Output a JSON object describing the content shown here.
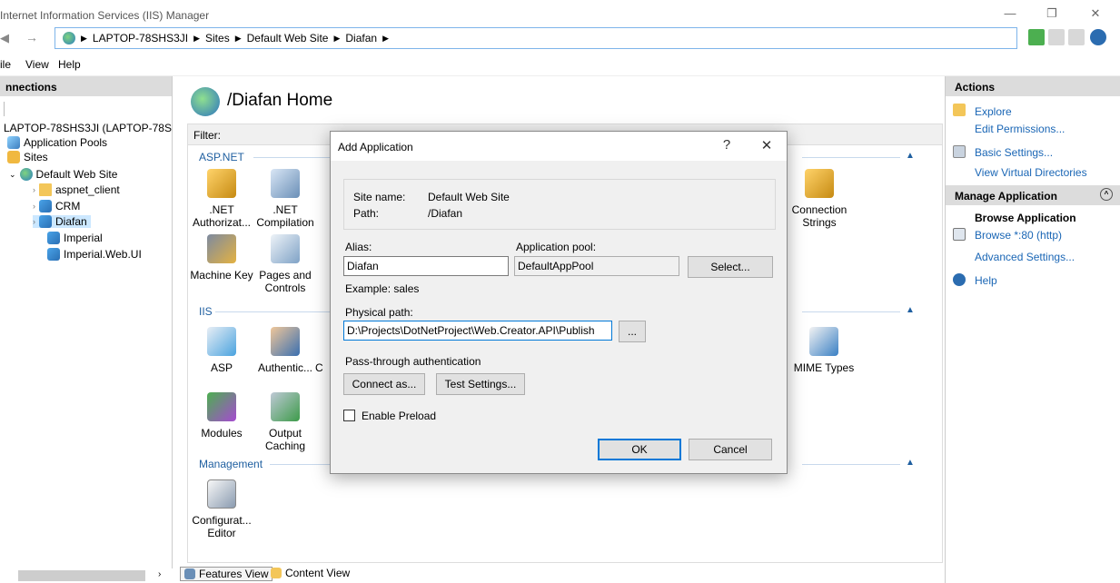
{
  "window": {
    "title": "Internet Information Services (IIS) Manager"
  },
  "address": {
    "crumbs": [
      "LAPTOP-78SHS3JI",
      "Sites",
      "Default Web Site",
      "Diafan"
    ]
  },
  "menu": {
    "items": [
      "ile",
      "View",
      "Help"
    ]
  },
  "connections": {
    "header": "nnections",
    "tree": [
      {
        "label": "LAPTOP-78SHS3JI (LAPTOP-78SH",
        "icon": "server-icon"
      },
      {
        "label": "Application Pools",
        "icon": "app-pool-icon"
      },
      {
        "label": "Sites",
        "icon": "sites-icon"
      },
      {
        "label": "Default Web Site",
        "icon": "globe-icon"
      },
      {
        "label": "aspnet_client",
        "icon": "folder-icon"
      },
      {
        "label": "CRM",
        "icon": "application-icon"
      },
      {
        "label": "Diafan",
        "icon": "application-icon"
      },
      {
        "label": "Imperial",
        "icon": "application-icon"
      },
      {
        "label": "Imperial.Web.UI",
        "icon": "application-icon"
      }
    ]
  },
  "center": {
    "title": "/Diafan Home",
    "filter_label": "Filter:",
    "groups": {
      "aspnet": "ASP.NET",
      "iis": "IIS",
      "management": "Management"
    },
    "features": {
      "net_auth": ".NET\nAuthorizat...",
      "net_comp": ".NET\nCompilation",
      "conn_strings": "Connection\nStrings",
      "machine_key": "Machine Key",
      "pages_controls": "Pages and\nControls",
      "asp": "ASP",
      "authentication": "Authentic...",
      "auth_c": "C",
      "mime": "MIME Types",
      "modules": "Modules",
      "output_caching": "Output\nCaching",
      "config_editor": "Configurat...\nEditor"
    }
  },
  "bottom_tabs": {
    "features": "Features View",
    "content": "Content View"
  },
  "actions": {
    "header": "Actions",
    "explore": "Explore",
    "edit_permissions": "Edit Permissions...",
    "basic_settings": "Basic Settings...",
    "view_virtual_dirs": "View Virtual Directories",
    "manage_header": "Manage Application",
    "browse_app": "Browse Application",
    "browse_80": "Browse *:80 (http)",
    "advanced_settings": "Advanced Settings...",
    "help": "Help"
  },
  "dialog": {
    "title": "Add Application",
    "help_glyph": "?",
    "close_glyph": "✕",
    "site_name_label": "Site name:",
    "site_name_value": "Default Web Site",
    "path_label": "Path:",
    "path_value": "/Diafan",
    "alias_label": "Alias:",
    "alias_value": "Diafan",
    "app_pool_label": "Application pool:",
    "app_pool_value": "DefaultAppPool",
    "select_button": "Select...",
    "example": "Example: sales",
    "physical_path_label": "Physical path:",
    "physical_path_value": "D:\\Projects\\DotNetProject\\Web.Creator.API\\Publish",
    "browse_button": "...",
    "pass_through_label": "Pass-through authentication",
    "connect_as_button": "Connect as...",
    "test_settings_button": "Test Settings...",
    "enable_preload_label": "Enable Preload",
    "enable_preload_checked": false,
    "ok_button": "OK",
    "cancel_button": "Cancel"
  }
}
